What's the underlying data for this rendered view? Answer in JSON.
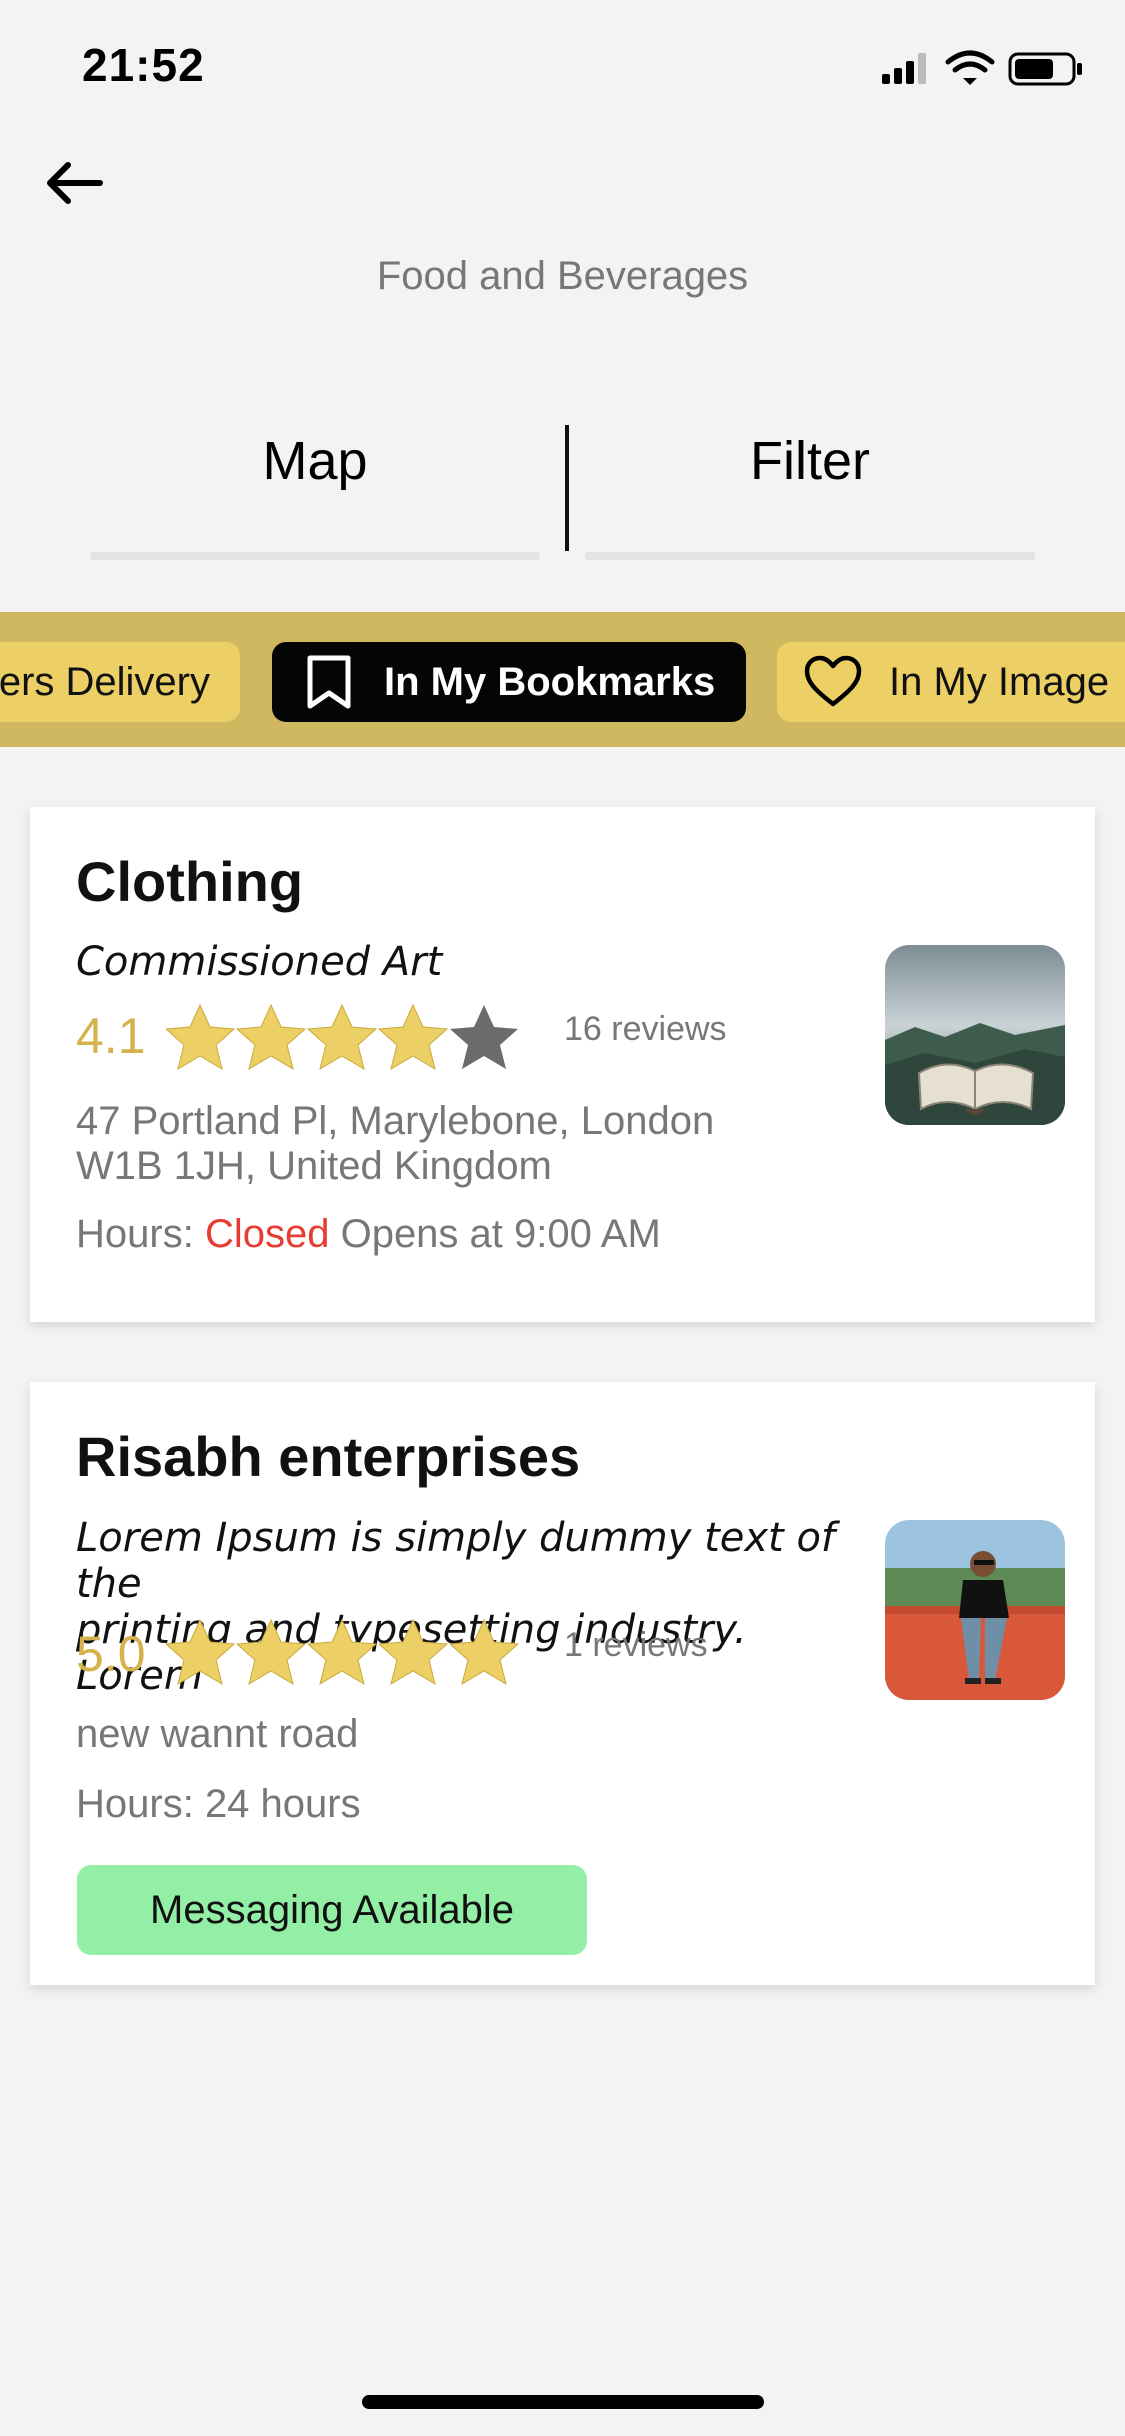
{
  "status_bar": {
    "time": "21:52"
  },
  "header": {
    "title": "Food and Beverages"
  },
  "tabs": [
    {
      "label": "Map"
    },
    {
      "label": "Filter"
    }
  ],
  "chips": [
    {
      "label": "ers Delivery",
      "icon": "none",
      "active": false
    },
    {
      "label": "In My Bookmarks",
      "icon": "bookmark-icon",
      "active": true
    },
    {
      "label": "In My Image",
      "icon": "heart-icon",
      "active": false
    }
  ],
  "listings": [
    {
      "title": "Clothing",
      "subtitle": "Commissioned Art",
      "rating": "4.1",
      "stars_filled": 4,
      "stars_total": 5,
      "reviews": "16 reviews",
      "address_line1": "47 Portland Pl, Marylebone, London",
      "address_line2": "W1B 1JH, United Kingdom",
      "hours_label": "Hours:",
      "hours_status": "Closed",
      "hours_detail": "Opens at 9:00 AM",
      "thumbnail": "open-book-in-misty-mountains"
    },
    {
      "title": "Risabh enterprises",
      "subtitle_line1": "Lorem Ipsum is simply dummy text of the",
      "subtitle_line2": "printing and typesetting industry. Lorem",
      "rating": "5.0",
      "stars_filled": 5,
      "stars_total": 5,
      "reviews": "1 reviews",
      "address": "new wannt road",
      "hours_label": "Hours:",
      "hours_detail": "24 hours",
      "badge": "Messaging Available",
      "thumbnail": "man-sitting-on-orange-wall"
    }
  ],
  "colors": {
    "background": "#f3f3f3",
    "chip_strip": "#cfb85f",
    "chip": "#ecd066",
    "chip_active": "#050505",
    "rating": "#d6b24c",
    "star_filled": "#ecd066",
    "star_empty": "#6b6b6b",
    "closed": "#e63c32",
    "badge": "#94efa6"
  }
}
